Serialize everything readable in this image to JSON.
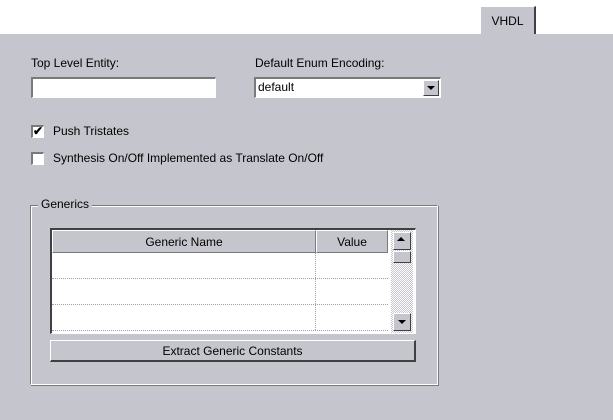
{
  "tabs": [
    {
      "label": "VHDL",
      "selected": true
    }
  ],
  "top_level_entity": {
    "label": "Top Level Entity:",
    "value": ""
  },
  "enum_encoding": {
    "label": "Default Enum Encoding:",
    "selected": "default"
  },
  "options": {
    "push_tristates": {
      "label": "Push Tristates",
      "checked": true,
      "mark": "✔"
    },
    "synthesis_translate": {
      "label": "Synthesis On/Off Implemented as Translate On/Off",
      "checked": false
    }
  },
  "generics": {
    "title": "Generics",
    "columns": [
      "Generic Name",
      "Value"
    ],
    "rows": [
      {
        "name": "",
        "value": ""
      },
      {
        "name": "",
        "value": ""
      },
      {
        "name": "",
        "value": ""
      }
    ],
    "extract_button": "Extract Generic Constants"
  },
  "colors": {
    "panel_bg": "#c5c5cd",
    "field_bg": "#ffffff"
  },
  "icons": {
    "dropdown": "chevron-down-icon",
    "scroll_up": "arrow-up-icon",
    "scroll_down": "arrow-down-icon",
    "check": "checkmark-icon"
  }
}
